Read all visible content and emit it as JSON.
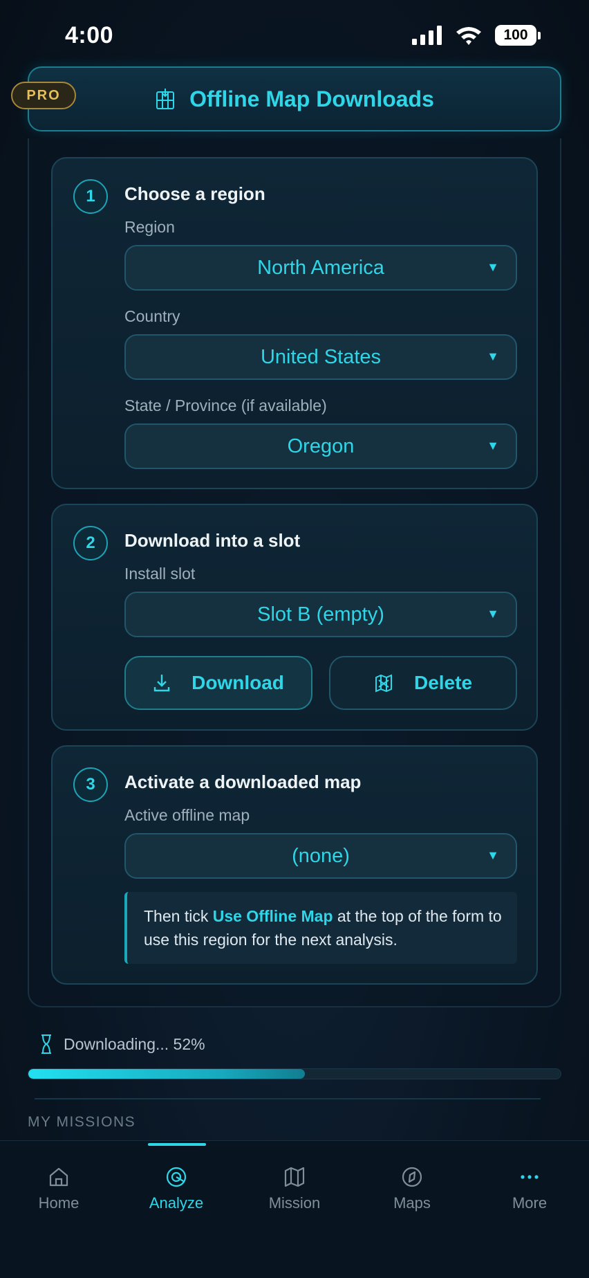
{
  "status_bar": {
    "time": "4:00",
    "battery": "100"
  },
  "header": {
    "title": "Offline Map Downloads",
    "badge": "PRO"
  },
  "step1": {
    "number": "1",
    "title": "Choose a region",
    "region_label": "Region",
    "region_value": "North America",
    "country_label": "Country",
    "country_value": "United States",
    "state_label": "State / Province (if available)",
    "state_value": "Oregon"
  },
  "step2": {
    "number": "2",
    "title": "Download into a slot",
    "slot_label": "Install slot",
    "slot_value": "Slot B (empty)",
    "download_label": "Download",
    "delete_label": "Delete"
  },
  "step3": {
    "number": "3",
    "title": "Activate a downloaded map",
    "active_label": "Active offline map",
    "active_value": "(none)",
    "note_prefix": "Then tick ",
    "note_highlight": "Use Offline Map",
    "note_suffix": " at the top of the form to use this region for the next analysis."
  },
  "progress": {
    "text": "Downloading... 52%",
    "value": 0.52
  },
  "section": {
    "label": "MY MISSIONS"
  },
  "tabs": [
    {
      "label": "Home",
      "icon": "home-icon"
    },
    {
      "label": "Analyze",
      "icon": "analyze-icon",
      "active": true
    },
    {
      "label": "Mission",
      "icon": "map-icon"
    },
    {
      "label": "Maps",
      "icon": "compass-icon"
    },
    {
      "label": "More",
      "icon": "more-icon"
    }
  ],
  "colors": {
    "accent": "#2fd6e8",
    "background": "#0a1624",
    "pro_gold": "#e5bf5a"
  }
}
